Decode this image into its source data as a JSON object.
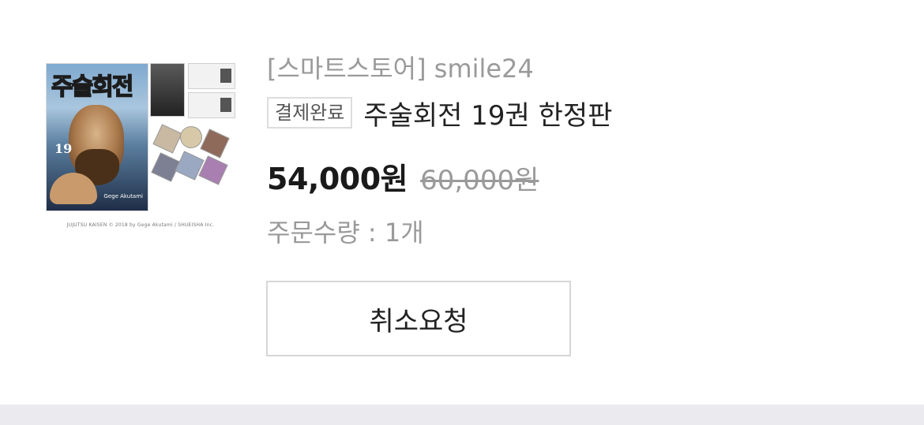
{
  "order": {
    "seller": "[스마트스토어] smile24",
    "status_badge": "결제완료",
    "product_title": "주술회전 19권 한정판",
    "price": "54,000원",
    "original_price": "60,000원",
    "quantity": "주문수량 : 1개",
    "cancel_button_label": "취소요청"
  },
  "thumbnail": {
    "cover_title": "주술회전",
    "volume": "19",
    "author": "Gege Akutami",
    "caption": "JUJUTSU KAISEN © 2018 by Gege Akutami / SHUEISHA Inc."
  },
  "colors": {
    "seller_text": "#9a9a9a",
    "title_text": "#222222",
    "badge_border": "#dddddd",
    "button_border": "#d6d6d6",
    "footer_bg": "#ebebef"
  }
}
